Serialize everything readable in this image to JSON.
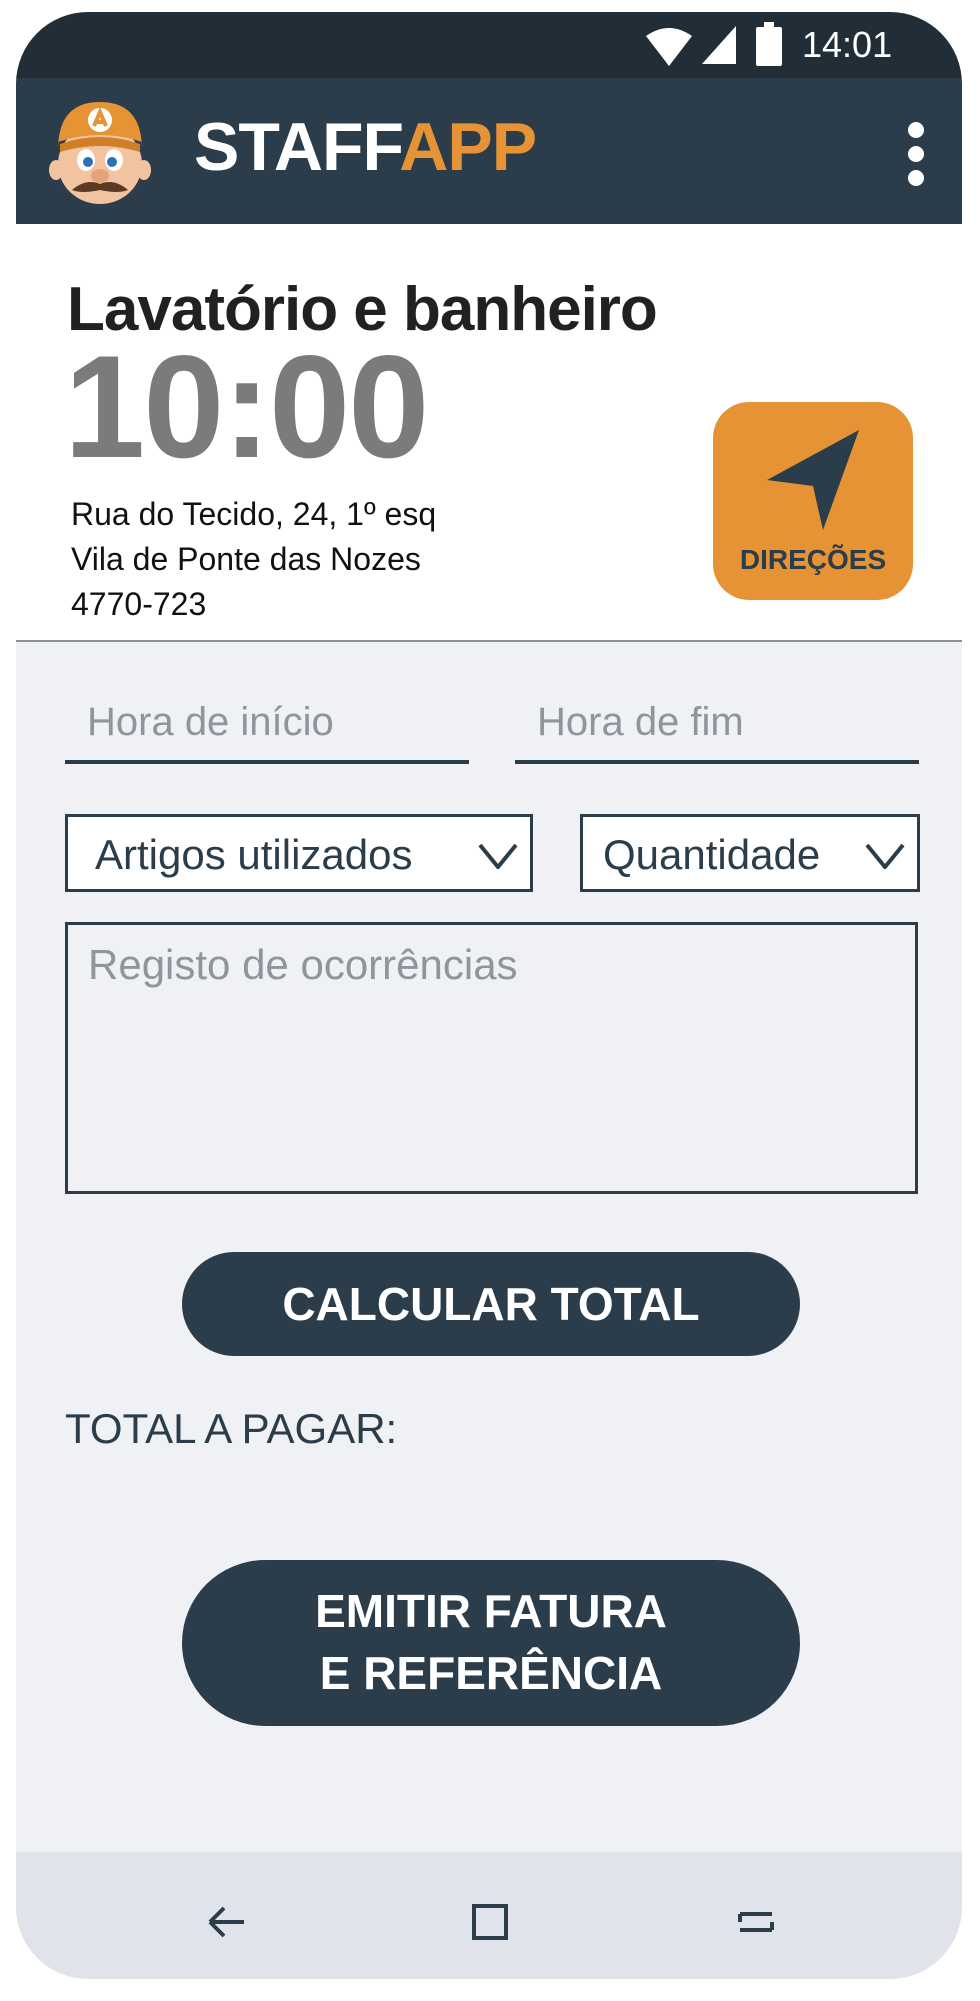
{
  "status": {
    "time": "14:01"
  },
  "appbar": {
    "brand_part1": "STAFF",
    "brand_part2": "APP"
  },
  "job": {
    "title": "Lavatório e banheiro",
    "time": "10:00",
    "address_line1": "Rua do Tecido, 24, 1º esq",
    "address_line2": "Vila de Ponte das Nozes",
    "postal_code": "4770-723",
    "directions_label": "DIREÇÕES"
  },
  "form": {
    "start_placeholder": "Hora de início",
    "end_placeholder": "Hora de fim",
    "items_select": "Artigos utilizados",
    "quantity_select": "Quantidade",
    "notes_placeholder": "Registo de ocorrências",
    "calculate_label": "CALCULAR TOTAL",
    "total_label": "TOTAL A PAGAR:",
    "invoice_label_line1": "EMITIR FATURA",
    "invoice_label_line2": "E REFERÊNCIA"
  },
  "icons": {
    "wifi": "wifi-icon",
    "signal": "signal-icon",
    "battery": "battery-icon",
    "menu": "more-vertical-icon",
    "directions": "navigation-arrow-icon",
    "back": "back-icon",
    "home": "home-icon",
    "recents": "recents-icon",
    "chevron": "chevron-down-icon"
  },
  "colors": {
    "primary": "#2b3d4a",
    "accent": "#e69335",
    "statusbar": "#212e37",
    "background": "#eff1f5"
  }
}
